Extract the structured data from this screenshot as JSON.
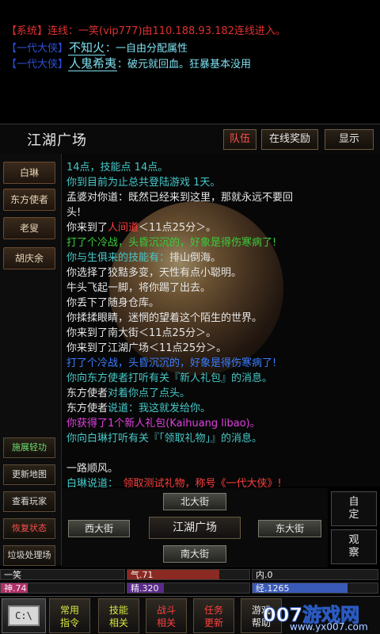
{
  "chat": {
    "lines": [
      {
        "tag": "【系统】",
        "text": "连线：一笑(vip777)由110.188.93.182连线进入。"
      },
      {
        "tag": "【一代大侠】",
        "name": "不知火",
        "text": "：一自由分配属性"
      },
      {
        "tag": "【一代大侠】",
        "name": "人鬼希夷",
        "text": "：破元就回血。狂暴基本没用"
      }
    ]
  },
  "header": {
    "room_title": "江湖广场",
    "team_btn": "队伍",
    "reward_btn": "在线奖励",
    "show_btn": "显示"
  },
  "npcs": [
    "白琳",
    "东方使者",
    "老叟",
    "胡庆余"
  ],
  "log": [
    {
      "parts": [
        {
          "c": "c-cyan",
          "t": "14点，技能点 14点。"
        }
      ]
    },
    {
      "parts": [
        {
          "c": "c-cyan",
          "t": "你到目前为止总共登陆游戏 1天。"
        }
      ]
    },
    {
      "parts": [
        {
          "c": "c-white",
          "t": "孟婆对你道：既然已经来到这里，那就永远不要回"
        }
      ]
    },
    {
      "parts": [
        {
          "c": "c-white",
          "t": "头!"
        }
      ]
    },
    {
      "parts": [
        {
          "c": "c-white",
          "t": "你来到了"
        },
        {
          "c": "c-red",
          "t": "人间道"
        },
        {
          "c": "c-white",
          "t": "＜11点25分＞。"
        }
      ]
    },
    {
      "parts": [
        {
          "c": "c-green",
          "t": "打了个冷战，头昏沉沉的，好象是得伤寒病了!"
        }
      ]
    },
    {
      "parts": [
        {
          "c": "c-cyan",
          "t": "你与生俱来的技能有："
        },
        {
          "c": "c-white",
          "t": "排山倒海。"
        }
      ]
    },
    {
      "parts": [
        {
          "c": "c-white",
          "t": "你选择了狡黠多变，天性有点小聪明。"
        }
      ]
    },
    {
      "parts": [
        {
          "c": "c-white",
          "t": "牛头飞起一脚，将你踢了出去。"
        }
      ]
    },
    {
      "parts": [
        {
          "c": "c-white",
          "t": "你丢下了随身仓库。"
        }
      ]
    },
    {
      "parts": [
        {
          "c": "c-white",
          "t": "你揉揉眼睛，迷惘的望着这个陌生的世界。"
        }
      ]
    },
    {
      "parts": [
        {
          "c": "c-white",
          "t": "你来到了南大街＜11点25分＞。"
        }
      ]
    },
    {
      "parts": [
        {
          "c": "c-white",
          "t": "你来到了江湖广场＜11点25分＞。"
        }
      ]
    },
    {
      "parts": [
        {
          "c": "c-blue",
          "t": "打了个冷战，头昏沉沉的，好象是得伤寒病了!"
        }
      ]
    },
    {
      "parts": [
        {
          "c": "c-cyan",
          "t": "你向东方使者打听有关『新人礼包』的消息。"
        }
      ]
    },
    {
      "parts": [
        {
          "c": "c-white",
          "t": "东方使者"
        },
        {
          "c": "c-cyan",
          "t": "对着你点了点头。"
        }
      ]
    },
    {
      "parts": [
        {
          "c": "c-white",
          "t": "东方使者"
        },
        {
          "c": "c-cyan",
          "t": "说道：我这就发给你。"
        }
      ]
    },
    {
      "parts": [
        {
          "c": "c-magenta",
          "t": "你获得了1个新人礼包(Kaihuang libao)。"
        }
      ]
    },
    {
      "parts": [
        {
          "c": "c-cyan",
          "t": "你向白琳打听有关『「领取礼物」』的消息。"
        }
      ]
    },
    {
      "parts": [
        {
          "c": "c-white",
          "t": ""
        }
      ]
    },
    {
      "parts": [
        {
          "c": "c-white",
          "t": "一路顺风。"
        }
      ]
    },
    {
      "parts": [
        {
          "c": "c-cyan",
          "t": "白琳说道："
        },
        {
          "c": "c-red",
          "t": "　领取测试礼物，称号《一代大侠》!"
        }
      ]
    }
  ],
  "tools": {
    "skill": "施展轻功",
    "refresh_map": "更新地图",
    "players": "查看玩家",
    "recover": "恢复状态",
    "trash": "垃圾处理场"
  },
  "map": {
    "north": "北大街",
    "west": "西大街",
    "center": "江湖广场",
    "east": "东大街",
    "south": "南大街"
  },
  "side": {
    "custom_l1": "自",
    "custom_l2": "定",
    "observe_l1": "观",
    "observe_l2": "察"
  },
  "stats": {
    "name": "一笑",
    "qi": "气.71",
    "nei": "内.0",
    "shen": "神.74",
    "jing": "精.320",
    "jingyan": "经.1265",
    "shen_level": 0.22,
    "jing_level": 0.3,
    "jingyan_level": 0.76,
    "qi_level": 0.75
  },
  "nav": {
    "terminal": "C:\\",
    "cmd_l1": "常用",
    "cmd_l2": "指令",
    "skill_l1": "技能",
    "skill_l2": "相关",
    "fight_l1": "战斗",
    "fight_l2": "相关",
    "task_l1": "任务",
    "task_l2": "更新",
    "help_l1": "游戏",
    "help_l2": "帮助"
  },
  "watermark": {
    "big": "007游戏网",
    "small": "www.yx007.com"
  }
}
